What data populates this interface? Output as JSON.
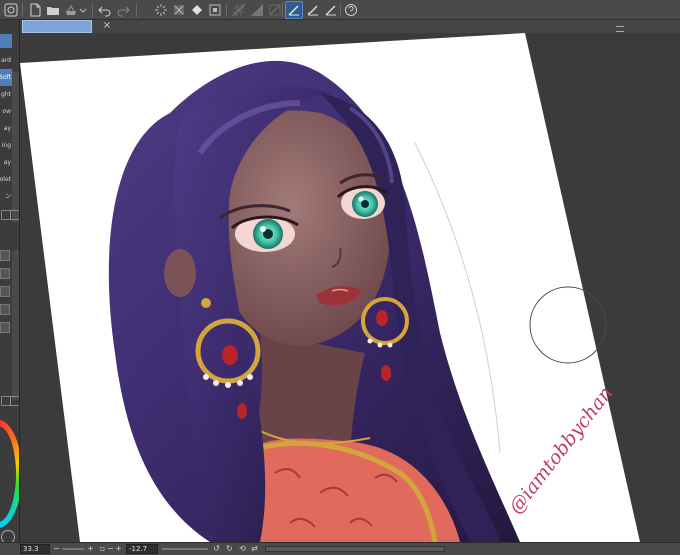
{
  "toolbar": {
    "icons": [
      "app-logo-icon",
      "new-file-icon",
      "open-folder-icon",
      "save-icon",
      "undo-icon",
      "redo-icon",
      "loading-icon",
      "clear-icon",
      "fill-icon",
      "transform-icon",
      "grid-icon",
      "ruler-icon",
      "stabilizer-icon",
      "pen-pressure-icon",
      "pen-stroke-icon",
      "ruler-snap-icon",
      "help-icon"
    ]
  },
  "tab": {
    "close_label": "×"
  },
  "layer_panel": {
    "blend_modes": [
      "ard",
      "Soft",
      "ght",
      "ow",
      "ay",
      "ing",
      "ay",
      "olet",
      "ン"
    ],
    "selected_index": 1
  },
  "canvas": {
    "signature": "@iamtobbychan",
    "colors": {
      "paper": "#ffffff",
      "hair": "#3b2a6b",
      "hair_highlight": "#6d5aa8",
      "skin": "#7a5258",
      "skin_light": "#a27a78",
      "eye": "#3fc3a8",
      "gold": "#d2a53d",
      "jewel": "#b8242a",
      "dress": "#e26a5c",
      "signature": "#c23a66"
    }
  },
  "statusbar": {
    "zoom": "33.3",
    "rotation": "-12.7",
    "minus_label": "−",
    "plus_label": "+",
    "rotate_minus_label": "−",
    "rotate_plus_label": "+"
  },
  "accent_color": "#4f7fb8"
}
